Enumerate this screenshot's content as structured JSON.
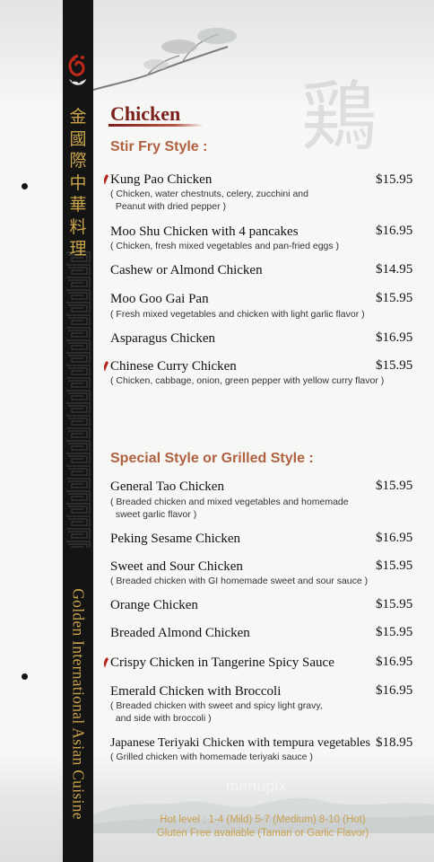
{
  "brand": {
    "chinese_name": [
      "金",
      "國",
      "際",
      "中",
      "華",
      "料",
      "理"
    ],
    "english_name": "Golden International Asian Cuisine",
    "background_glyph": "鶏"
  },
  "menu": {
    "title": "Chicken",
    "sections": [
      {
        "heading": "Stir Fry Style :",
        "items": [
          {
            "name": "Kung Pao Chicken",
            "price": "$15.95",
            "desc": "( Chicken, water chestnuts, celery, zucchini and\n  Peanut with dried pepper )",
            "spicy": true
          },
          {
            "name": "Moo Shu Chicken with 4 pancakes",
            "price": "$16.95",
            "desc": "( Chicken, fresh mixed vegetables and pan-fried eggs )",
            "spicy": false
          },
          {
            "name": "Cashew or Almond Chicken",
            "price": "$14.95",
            "desc": "",
            "spicy": false
          },
          {
            "name": "Moo Goo Gai Pan",
            "price": "$15.95",
            "desc": "( Fresh mixed vegetables and chicken with light garlic flavor )",
            "spicy": false
          },
          {
            "name": "Asparagus Chicken",
            "price": "$16.95",
            "desc": "",
            "spicy": false
          },
          {
            "name": "Chinese Curry Chicken",
            "price": "$15.95",
            "desc": "( Chicken, cabbage, onion, green pepper with yellow curry flavor )",
            "spicy": true
          }
        ]
      },
      {
        "heading": "Special Style or Grilled Style :",
        "items": [
          {
            "name": "General Tao Chicken",
            "price": "$15.95",
            "desc": "( Breaded chicken and mixed vegetables and homemade\n  sweet garlic flavor )",
            "spicy": false
          },
          {
            "name": "Peking Sesame Chicken",
            "price": "$16.95",
            "desc": "",
            "spicy": false
          },
          {
            "name": "Sweet and Sour Chicken",
            "price": "$15.95",
            "desc": "( Breaded chicken with GI homemade sweet and sour sauce )",
            "spicy": false
          },
          {
            "name": "Orange Chicken",
            "price": "$15.95",
            "desc": "",
            "spicy": false
          },
          {
            "name": "Breaded Almond Chicken",
            "price": "$15.95",
            "desc": "",
            "spicy": false
          },
          {
            "name": "Crispy Chicken in Tangerine Spicy Sauce",
            "price": "$16.95",
            "desc": "",
            "spicy": true
          },
          {
            "name": "Emerald Chicken with Broccoli",
            "price": "$16.95",
            "desc": "( Breaded chicken with sweet and spicy light gravy,\n  and side with broccoli )",
            "spicy": false
          },
          {
            "name": "Japanese Teriyaki Chicken with tempura vegetables",
            "price": "$18.95",
            "desc": "( Grilled chicken with homemade teriyaki sauce )",
            "spicy": false
          }
        ]
      }
    ]
  },
  "footer": {
    "hot_level": "Hot level : 1-4 (Mild) 5-7 (Medium) 8-10 (Hot)",
    "gluten_free": "Gluten Free available (Tamari or Garlic Flavor)"
  },
  "watermark": "menupix",
  "colors": {
    "title": "#7a1f1a",
    "section_heading": "#b0613f",
    "gold": "#c9a44a",
    "chili": "#b8231c",
    "spine": "#141414"
  }
}
